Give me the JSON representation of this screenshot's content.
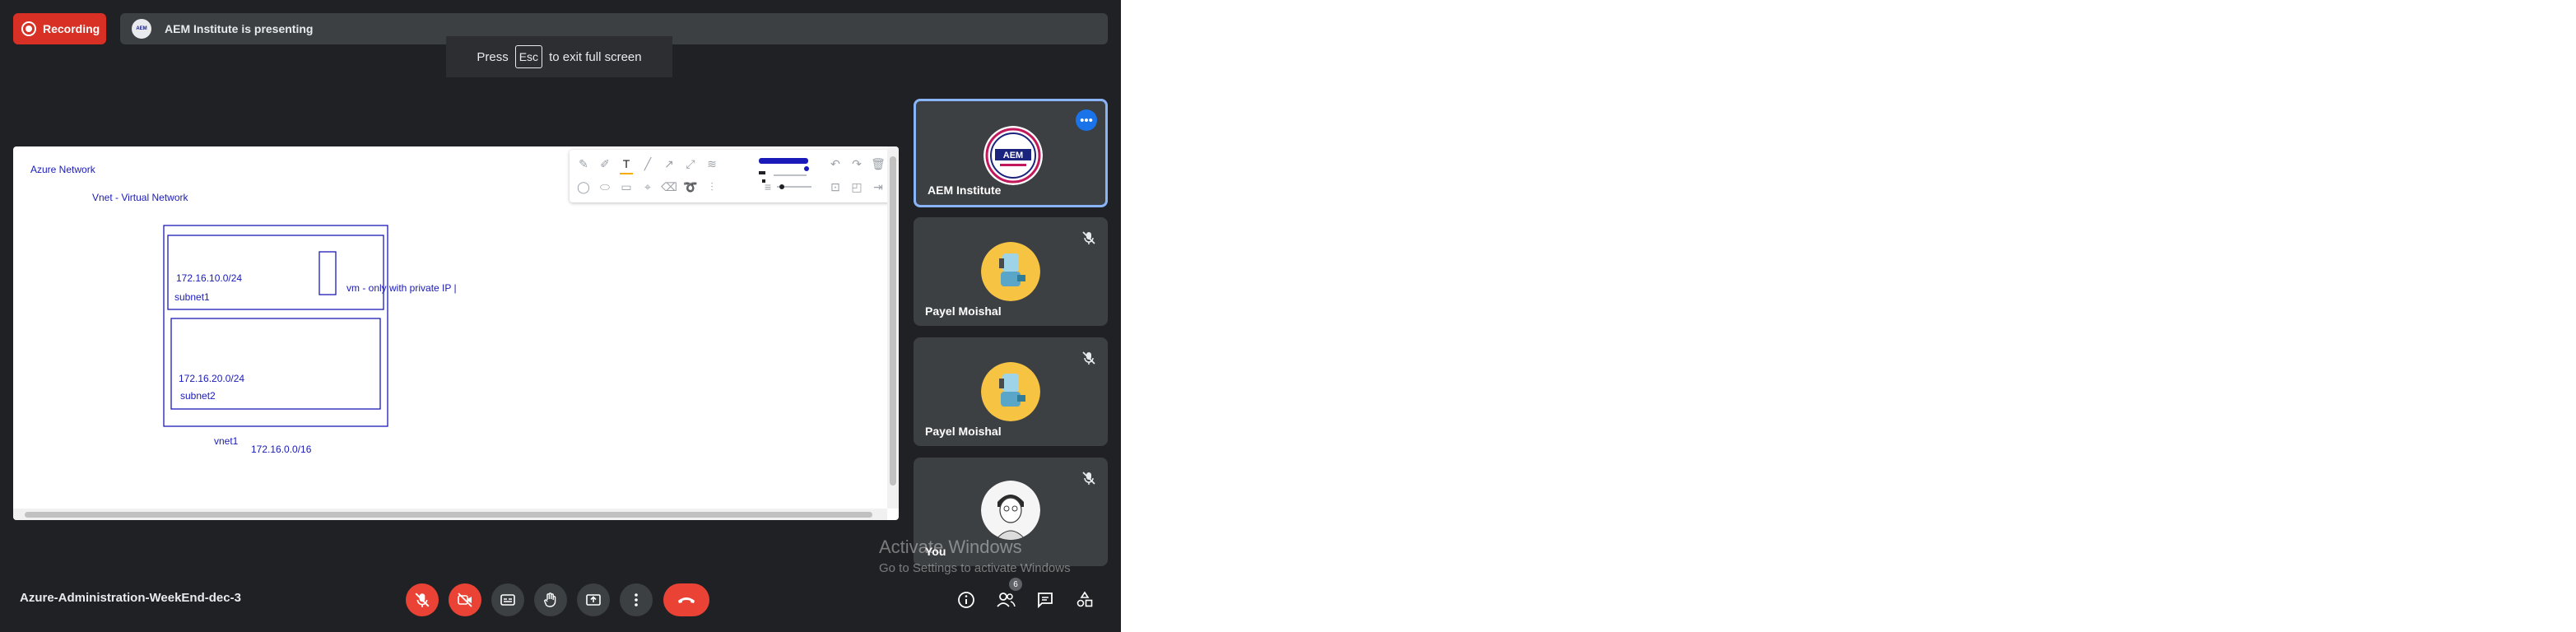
{
  "recording": {
    "label": "Recording"
  },
  "presentation": {
    "presenter_initials": "AEM",
    "banner": "AEM Institute is presenting"
  },
  "fullscreen_toast": {
    "prefix": "Press",
    "key": "Esc",
    "suffix": "to exit full screen"
  },
  "whiteboard": {
    "labels": {
      "title": "Azure Network",
      "vnet_title": "Vnet - Virtual Network",
      "subnet1_cidr": "172.16.10.0/24",
      "subnet1_name": "subnet1",
      "vm_note": "vm - only with private IP |",
      "subnet2_cidr": "172.16.20.0/24",
      "subnet2_name": "subnet2",
      "vnet_name": "vnet1",
      "vnet_cidr": "172.16.0.0/16"
    },
    "ink_color": "#1a1ab8",
    "toolbar_tools": [
      "pen-icon",
      "marker-icon",
      "text-tool-icon",
      "line-icon",
      "arrow-icon",
      "double-arrow-icon",
      "highlighter-icon",
      "undo-icon",
      "redo-icon",
      "delete-icon",
      "circle-icon",
      "ellipse-icon",
      "rectangle-icon",
      "select-icon",
      "eraser-icon",
      "lasso-icon",
      "settings-sliders-icon",
      "image-icon",
      "sticky-note-icon",
      "exit-icon"
    ]
  },
  "participants": [
    {
      "name": "AEM Institute",
      "avatar": "aem-logo",
      "muted": false,
      "active_speaker": true
    },
    {
      "name": "Payel Moishal",
      "avatar": "cartoon-avatar",
      "muted": true
    },
    {
      "name": "Payel Moishal",
      "avatar": "cartoon-avatar",
      "muted": true
    },
    {
      "name": "You",
      "avatar": "sketch-avatar",
      "muted": true
    }
  ],
  "watermark": {
    "title": "Activate Windows",
    "subtitle": "Go to Settings to activate Windows"
  },
  "meeting": {
    "title": "Azure-Administration-WeekEnd-dec-3"
  },
  "controls": {
    "people_count": "6",
    "buttons": [
      "mic-off-icon",
      "camera-off-icon",
      "captions-icon",
      "raise-hand-icon",
      "present-icon",
      "more-options-icon",
      "end-call-icon",
      "info-icon",
      "people-icon",
      "chat-icon",
      "activities-icon"
    ]
  },
  "colors": {
    "background": "#202124",
    "tile": "#3c4043",
    "danger": "#ea4335",
    "accent": "#8ab4f8",
    "recording": "#d93025"
  }
}
